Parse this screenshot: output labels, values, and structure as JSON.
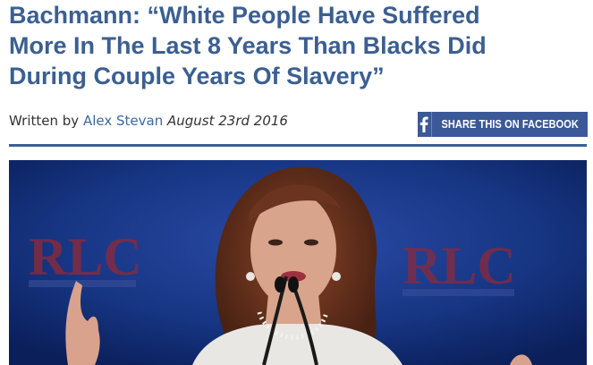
{
  "article": {
    "headline_lines": [
      "Bachmann: “White People Have Suffered",
      "More In The Last 8 Years Than Blacks Did",
      "During Couple Years Of Slavery”"
    ],
    "byline": {
      "prefix": "Written by",
      "author": "Alex Stevan",
      "date": "August 23rd 2016"
    },
    "share_button_label": "SHARE THIS ON FACEBOOK",
    "photo": {
      "backdrop_logo_text": "RLC",
      "colors": {
        "background_blue": "#10296e",
        "logo_red": "#8a2a3c",
        "hair": "#6b3420",
        "skin": "#d9a48c"
      }
    }
  },
  "colors": {
    "headline": "#3b5f91",
    "link": "#3b6aa0",
    "facebook": "#3b5998",
    "rule": "#3b5f91"
  }
}
